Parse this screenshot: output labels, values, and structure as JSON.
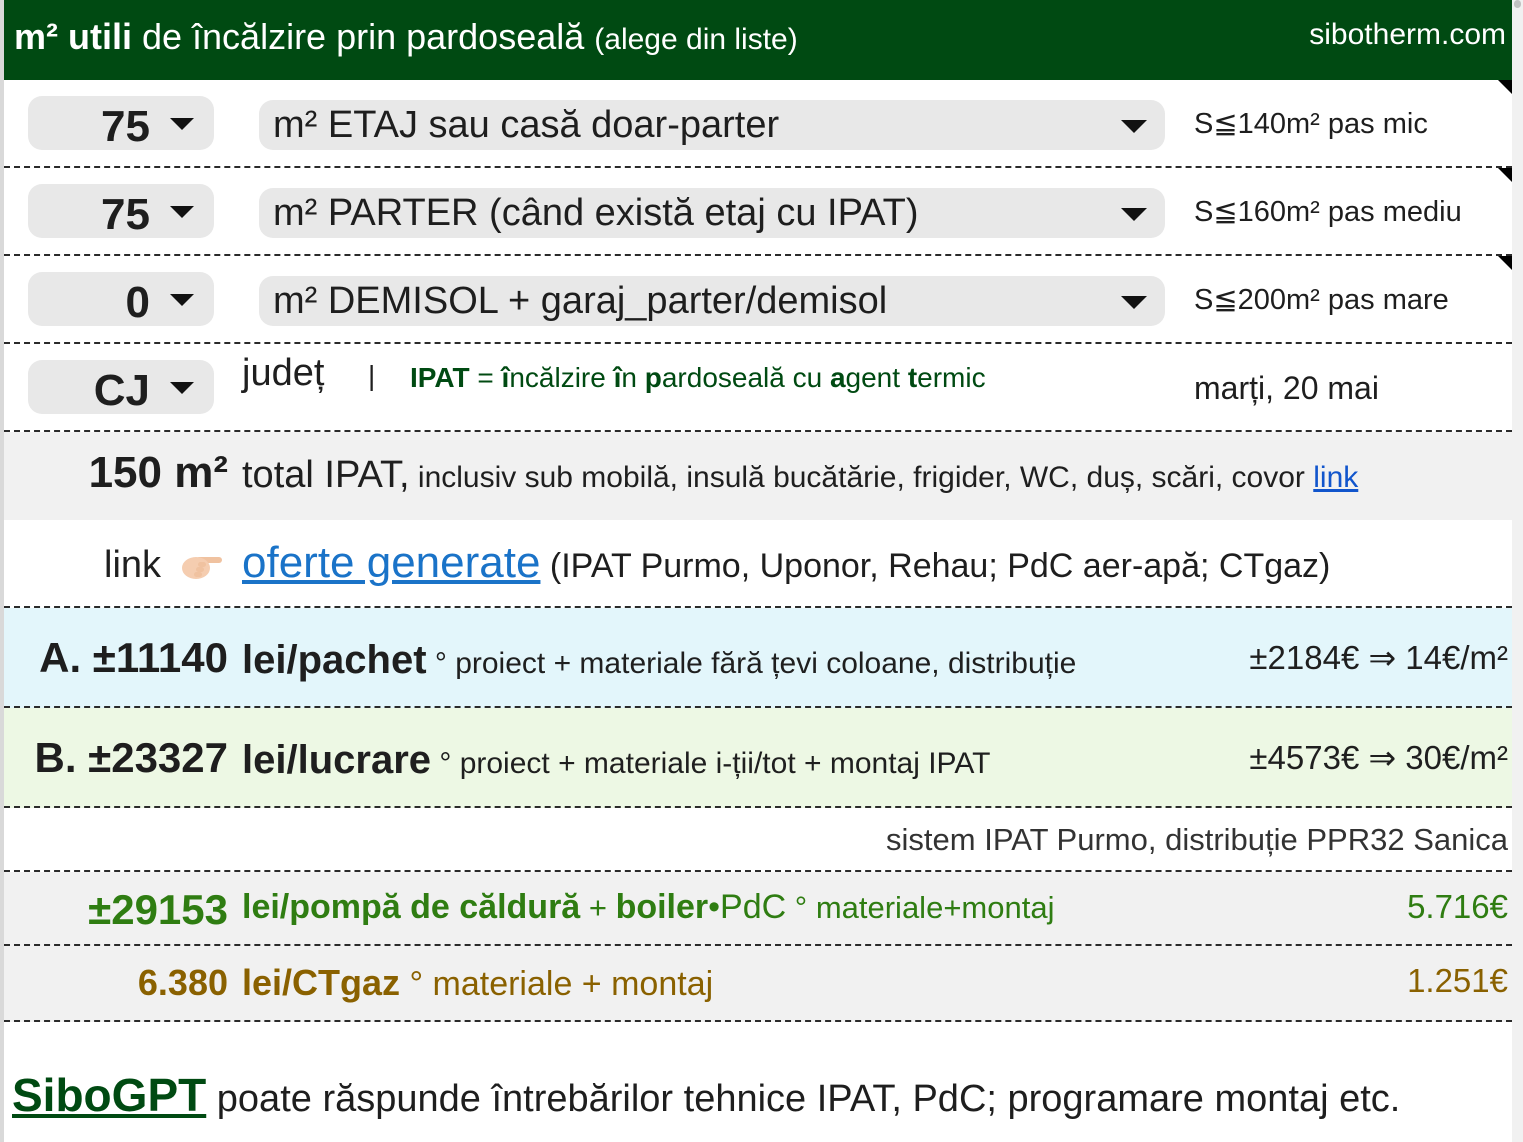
{
  "header": {
    "title_bold": "m² utili",
    "title_rest": " de încălzire prin pardoseală",
    "title_hint": "(alege din liste)",
    "site": "sibotherm.com"
  },
  "rows": [
    {
      "value": "75",
      "label": "m² ETAJ sau casă doar-parter",
      "side": "S≦140m² pas mic"
    },
    {
      "value": "75",
      "label": "m² PARTER (când există etaj cu IPAT)",
      "side": "S≦160m² pas mediu"
    },
    {
      "value": "0",
      "label": "m² DEMISOL + garaj_parter/demisol",
      "side": "S≦200m² pas mare"
    }
  ],
  "county": {
    "value": "CJ",
    "label": "județ",
    "separator": "|",
    "ipat_def": {
      "abbr": "IPAT",
      "eq": " = ",
      "i": "î",
      "ncalzire": "ncălzire ",
      "in_i": "î",
      "in_rest": "n ",
      "p": "p",
      "ardoseala": "ardoseală cu ",
      "a": "a",
      "gent": "gent ",
      "t": "t",
      "ermic": "ermic"
    },
    "date": "marți, 20 mai"
  },
  "total": {
    "number": "150 m²",
    "big": "total IPAT,",
    "rest": " inclusiv sub mobilă, insulă bucătărie, frigider, WC, duș, scări, covor ",
    "link": "link"
  },
  "offers": {
    "word": "link",
    "link": "oferte generate",
    "rest": " (IPAT Purmo, Uponor, Rehau; PdC aer-apă; CTgaz)"
  },
  "packages": [
    {
      "id": "A. ±11140",
      "unit": "lei/pachet",
      "deg": " °",
      "desc": " proiect + materiale fără țevi coloane, distribuție",
      "right": "±2184€ ⇒ 14€/m²",
      "bg": "#e3f6fb"
    },
    {
      "id": "B. ±23327",
      "unit": "lei/lucrare",
      "deg": " °",
      "desc": " proiect + materiale i-ții/tot + montaj IPAT",
      "right": "±4573€ ⇒ 30€/m²",
      "bg": "#edf8e4"
    }
  ],
  "system": "sistem IPAT Purmo, distribuție PPR32 Sanica",
  "heatpump": {
    "amount": "±29153",
    "unit_bold": "lei/pompă de căldură",
    "plus": " + ",
    "boiler": "boiler",
    "dot": "•PdC",
    "deg": " °",
    "desc": " materiale+montaj",
    "right": "5.716€"
  },
  "ctgaz": {
    "amount": "6.380",
    "unit": "lei/CTgaz",
    "deg": " °",
    "desc": " materiale + montaj",
    "right": "1.251€"
  },
  "footer": {
    "link": "SiboGPT",
    "text": " poate răspunde întrebărilor tehnice IPAT, PdC; programare montaj etc."
  },
  "colors": {
    "header_bg": "#004a12",
    "green_text": "#2f7d12",
    "brown_text": "#8a6100",
    "link": "#1a73c8"
  }
}
